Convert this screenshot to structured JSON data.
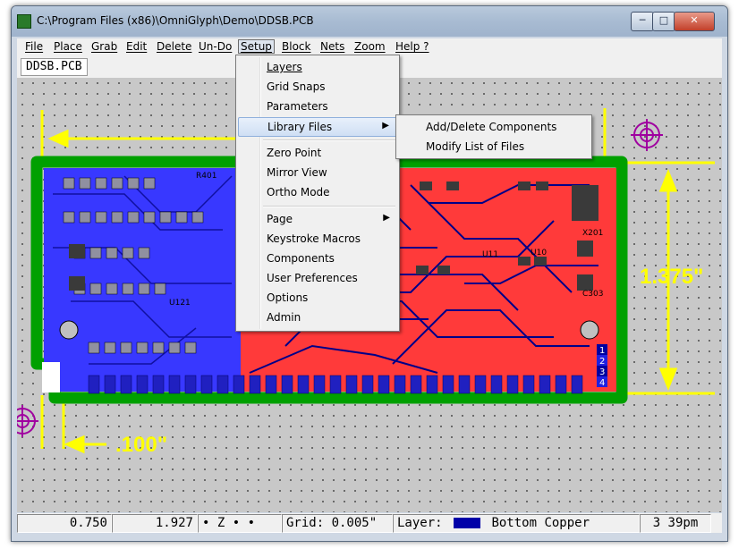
{
  "window": {
    "title": "C:\\Program Files (x86)\\OmniGlyph\\Demo\\DDSB.PCB",
    "min_label": "─",
    "max_label": "□",
    "close_label": "✕"
  },
  "menubar": {
    "items": [
      "File",
      "Place",
      "Grab",
      "Edit",
      "Delete",
      "Un-Do",
      "Setup",
      "Block",
      "Nets",
      "Zoom",
      "Help ?"
    ]
  },
  "document": {
    "tab_label": "DDSB.PCB"
  },
  "setup_menu": {
    "items": [
      {
        "label": "Layers"
      },
      {
        "label": "Grid Snaps"
      },
      {
        "label": "Parameters"
      },
      {
        "label": "Library Files",
        "submenu": true
      },
      {
        "label": "Zero Point"
      },
      {
        "label": "Mirror View"
      },
      {
        "label": "Ortho Mode"
      },
      {
        "label": "Page",
        "submenu": true
      },
      {
        "label": "Keystroke Macros"
      },
      {
        "label": "Components"
      },
      {
        "label": "User Preferences"
      },
      {
        "label": "Options"
      },
      {
        "label": "Admin"
      }
    ],
    "highlighted": "Library Files",
    "arrow_glyph": "▶"
  },
  "library_submenu": {
    "items": [
      "Add/Delete Components",
      "Modify List of Files"
    ]
  },
  "board": {
    "dimension_height": "1.375\"",
    "dimension_offset": ".100\"",
    "component_labels": [
      "X201",
      "C303",
      "U11",
      "U10",
      "U121",
      "R401"
    ],
    "layer_badges": [
      "1",
      "2",
      "3",
      "4"
    ]
  },
  "statusbar": {
    "x_coord": "0.750",
    "y_coord": "1.927",
    "mode": "• Z • •",
    "grid": "Grid: 0.005\"",
    "layer_label": "Layer:",
    "layer_name": "Bottom Copper",
    "layer_color": "#0000a8",
    "time": "3 39pm"
  },
  "colors": {
    "board_outline": "#00a000",
    "top_copper": "#ff3c3c",
    "bottom_copper": "#3030ff",
    "dimension": "#ffff00",
    "target": "#a000a0",
    "canvas_bg": "#c8c8c8"
  }
}
